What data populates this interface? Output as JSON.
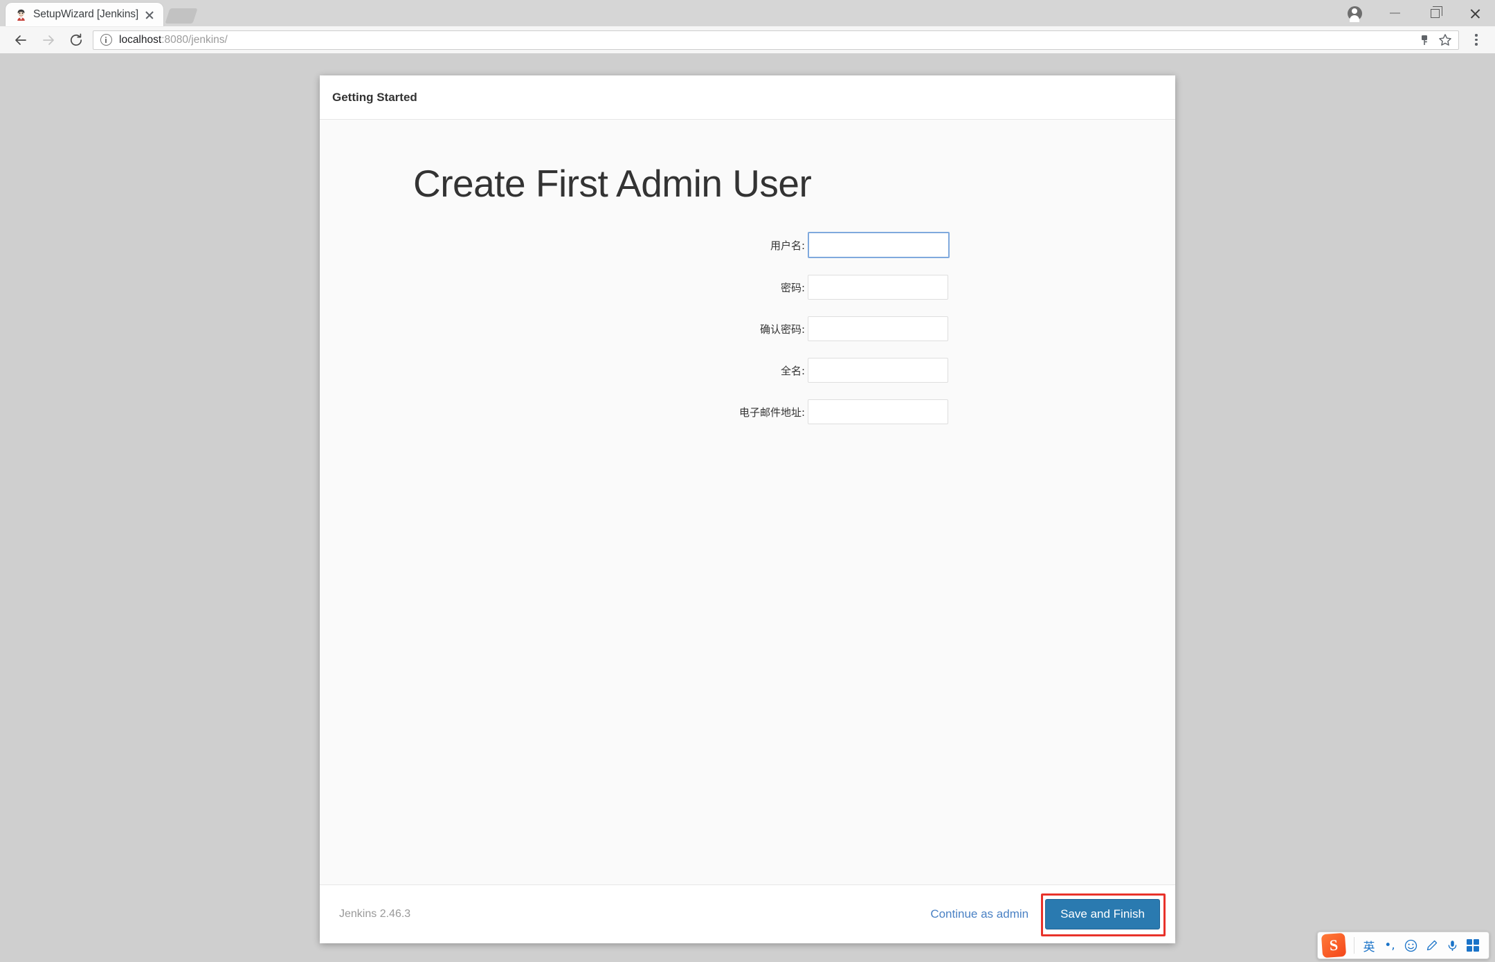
{
  "browser": {
    "tab": {
      "title": "SetupWizard [Jenkins]",
      "favicon_name": "jenkins-butler-favicon",
      "close_label": "×"
    },
    "new_tab_label": "",
    "window_controls": {
      "profile": "profile-avatar",
      "minimize": "–",
      "maximize": "❐",
      "close": "×"
    },
    "toolbar": {
      "back_label": "←",
      "forward_label": "→",
      "reload_label": "↻",
      "url_host": "localhost",
      "url_rest": ":8080/jenkins/",
      "url_full": "localhost:8080/jenkins/",
      "security_icon": "info-circle-icon",
      "key_icon": "key-icon",
      "star_icon": "star-icon",
      "menu_icon": "three-dot-menu-icon"
    }
  },
  "setup": {
    "header_title": "Getting Started",
    "page_title": "Create First Admin User",
    "fields": [
      {
        "label": "用户名:",
        "value": "",
        "type": "text",
        "name": "username-field",
        "focused": true
      },
      {
        "label": "密码:",
        "value": "",
        "type": "password",
        "name": "password-field",
        "focused": false
      },
      {
        "label": "确认密码:",
        "value": "",
        "type": "password",
        "name": "confirm-password-field",
        "focused": false
      },
      {
        "label": "全名:",
        "value": "",
        "type": "text",
        "name": "fullname-field",
        "focused": false
      },
      {
        "label": "电子邮件地址:",
        "value": "",
        "type": "text",
        "name": "email-field",
        "focused": false
      }
    ],
    "footer": {
      "version": "Jenkins 2.46.3",
      "continue_link": "Continue as admin",
      "save_button": "Save and Finish",
      "annotation_color": "#e8322a",
      "save_button_color": "#2a7ab0",
      "link_color": "#4a81c4"
    }
  },
  "ime": {
    "logo": "S",
    "mode": "英",
    "punctuation": "•,",
    "emoji": "☺",
    "pen": "✎",
    "mic": "⚑",
    "grid": "apps-grid-icon"
  }
}
